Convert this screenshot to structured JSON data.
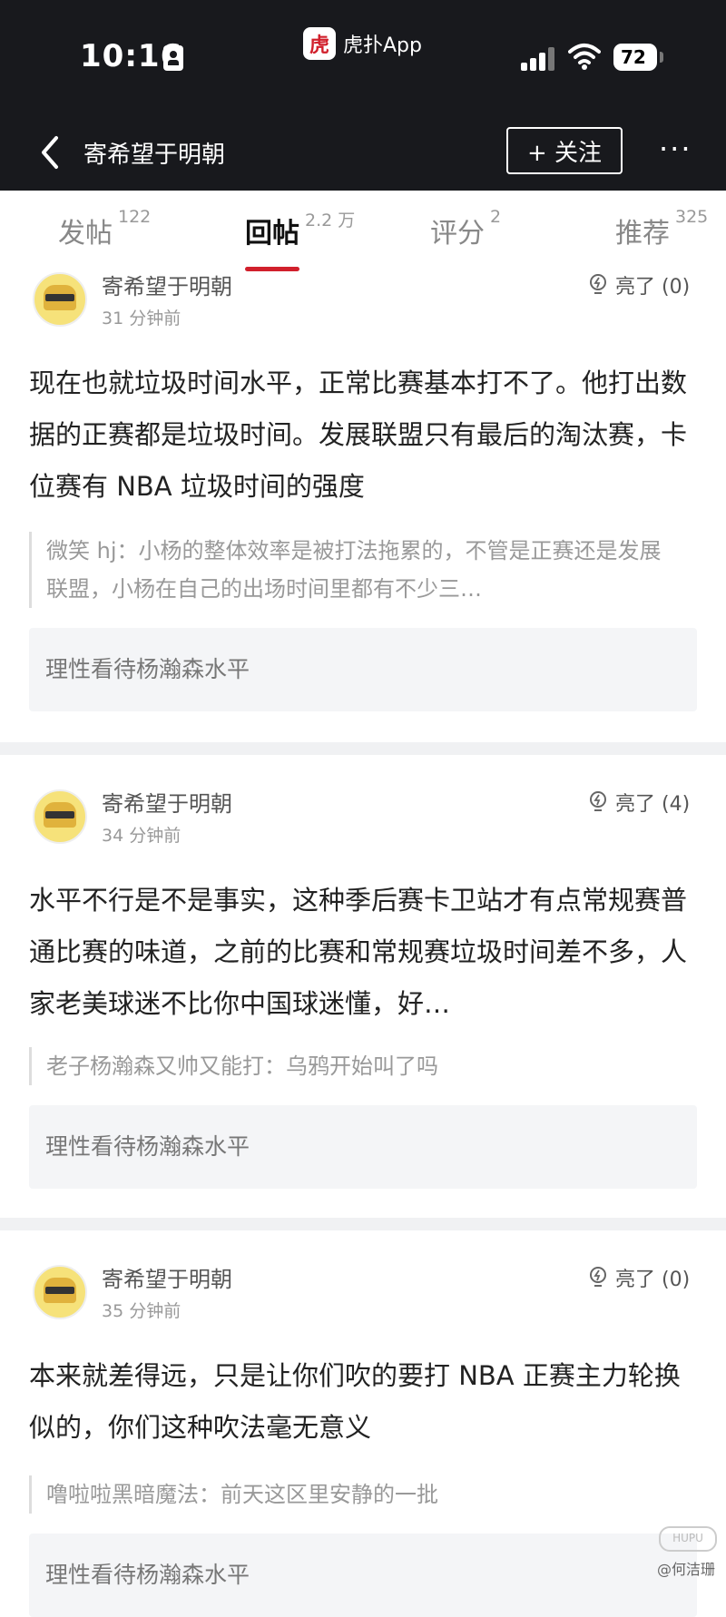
{
  "status_bar": {
    "time": "10:16",
    "app_logo_text": "虎",
    "app_name": "虎扑App",
    "battery": "72"
  },
  "nav": {
    "title": "寄希望于明朝",
    "follow_label": "+ 关注",
    "more_label": "···"
  },
  "tabs": [
    {
      "label": "发帖",
      "count": "122"
    },
    {
      "label": "回帖",
      "count": "2.2 万"
    },
    {
      "label": "评分",
      "count": "2"
    },
    {
      "label": "推荐",
      "count": "325"
    }
  ],
  "posts": [
    {
      "username": "寄希望于明朝",
      "time": "31 分钟前",
      "like": "亮了 (0)",
      "body": "现在也就垃圾时间水平，正常比赛基本打不了。他打出数据的正赛都是垃圾时间。发展联盟只有最后的淘汰赛，卡位赛有 NBA 垃圾时间的强度",
      "quote": "微笑 hj：小杨的整体效率是被打法拖累的，不管是正赛还是发展联盟，小杨在自己的出场时间里都有不少三…",
      "topic": "理性看待杨瀚森水平"
    },
    {
      "username": "寄希望于明朝",
      "time": "34 分钟前",
      "like": "亮了 (4)",
      "body": "水平不行是不是事实，这种季后赛卡卫站才有点常规赛普通比赛的味道，之前的比赛和常规赛垃圾时间差不多，人家老美球迷不比你中国球迷懂，好…",
      "quote": "老子杨瀚森又帅又能打：乌鸦开始叫了吗",
      "topic": "理性看待杨瀚森水平"
    },
    {
      "username": "寄希望于明朝",
      "time": "35 分钟前",
      "like": "亮了 (0)",
      "body": "本来就差得远，只是让你们吹的要打 NBA 正赛主力轮换似的，你们这种吹法毫无意义",
      "quote": "噜啦啦黑暗魔法：前天这区里安静的一批",
      "topic": "理性看待杨瀚森水平"
    }
  ],
  "watermark": {
    "logo": "HUPU",
    "text": "@何洁珊"
  }
}
